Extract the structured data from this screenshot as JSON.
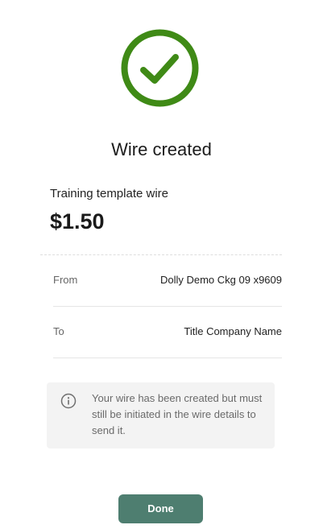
{
  "status": {
    "icon": "check-circle-icon",
    "color": "#3f8a16",
    "title": "Wire created"
  },
  "wire": {
    "template_name": "Training template wire",
    "amount": "$1.50"
  },
  "details": {
    "from": {
      "label": "From",
      "value": "Dolly Demo Ckg 09 x9609"
    },
    "to": {
      "label": "To",
      "value": "Title Company Name"
    }
  },
  "info": {
    "icon": "info-circle-icon",
    "message": "Your wire has been created but must still be initiated in the wire details to send it."
  },
  "actions": {
    "done_label": "Done",
    "done_color": "#4e7e70"
  }
}
